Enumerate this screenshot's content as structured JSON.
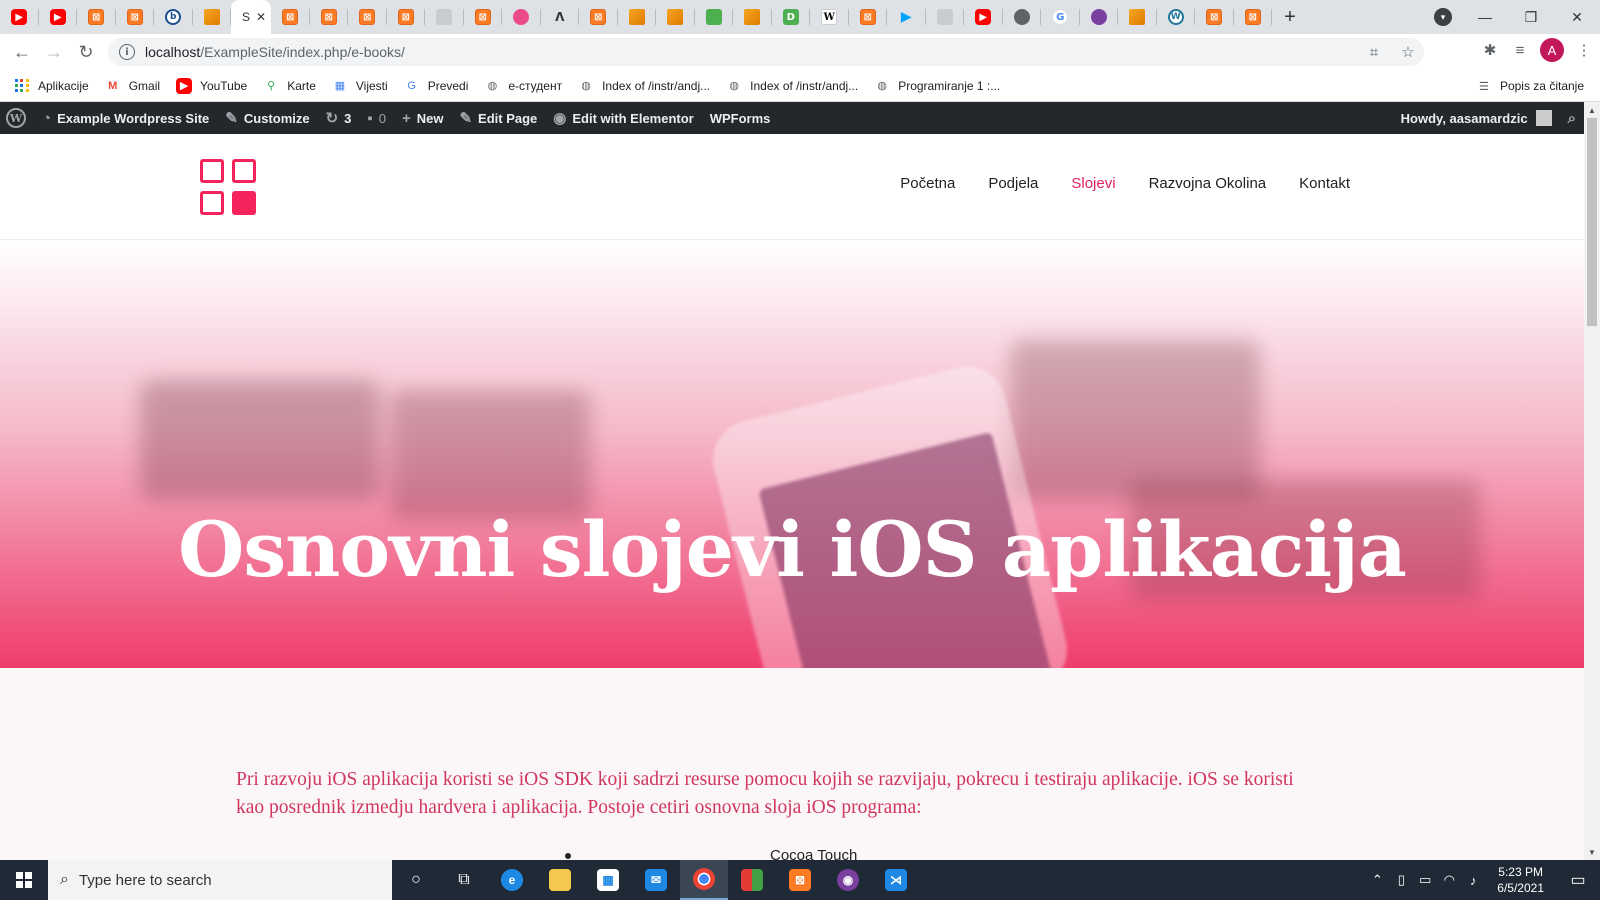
{
  "browser": {
    "tabs": [
      {
        "favicon": "youtube-icon"
      },
      {
        "favicon": "youtube-icon"
      },
      {
        "favicon": "xampp-icon"
      },
      {
        "favicon": "xampp-icon"
      },
      {
        "favicon": "b-icon"
      },
      {
        "favicon": "phpmyadmin-icon"
      },
      {
        "favicon": "page-icon",
        "title": "S",
        "active": true
      },
      {
        "favicon": "xampp-icon"
      },
      {
        "favicon": "xampp-icon"
      },
      {
        "favicon": "xampp-icon"
      },
      {
        "favicon": "xampp-icon"
      },
      {
        "favicon": "xampp-icon"
      },
      {
        "favicon": "xampp-icon"
      },
      {
        "favicon": "dribbble-icon"
      },
      {
        "favicon": "delta-icon"
      },
      {
        "favicon": "xampp-icon"
      },
      {
        "favicon": "phpmyadmin-icon"
      },
      {
        "favicon": "phpmyadmin-icon"
      },
      {
        "favicon": "green-icon"
      },
      {
        "favicon": "folder-icon"
      },
      {
        "favicon": "d-icon"
      },
      {
        "favicon": "wikipedia-icon"
      },
      {
        "favicon": "xampp-icon"
      },
      {
        "favicon": "play-icon"
      },
      {
        "favicon": "people-icon"
      },
      {
        "favicon": "youtube-icon"
      },
      {
        "favicon": "globe-icon"
      },
      {
        "favicon": "google-icon"
      },
      {
        "favicon": "purple-icon"
      },
      {
        "favicon": "yellow-icon"
      },
      {
        "favicon": "wordpress-icon"
      },
      {
        "favicon": "xampp-icon"
      },
      {
        "favicon": "xampp-icon"
      }
    ],
    "url_host": "localhost",
    "url_path": "/ExampleSite/index.php/e-books/",
    "profile_initial": "A",
    "bookmarks": [
      {
        "label": "Aplikacije",
        "icon": "apps-grid-icon"
      },
      {
        "label": "Gmail",
        "icon": "gmail-icon"
      },
      {
        "label": "YouTube",
        "icon": "youtube-icon"
      },
      {
        "label": "Karte",
        "icon": "maps-icon"
      },
      {
        "label": "Vijesti",
        "icon": "news-icon"
      },
      {
        "label": "Prevedi",
        "icon": "translate-icon"
      },
      {
        "label": "e-студент",
        "icon": "globe-icon"
      },
      {
        "label": "Index of /instr/andj...",
        "icon": "globe-icon"
      },
      {
        "label": "Index of /instr/andj...",
        "icon": "globe-icon"
      },
      {
        "label": "Programiranje 1 :...",
        "icon": "globe-icon"
      }
    ],
    "reading_list": "Popis za čitanje"
  },
  "adminbar": {
    "site_name": "Example Wordpress Site",
    "customize": "Customize",
    "updates_count": "3",
    "comments_count": "0",
    "new": "New",
    "edit_page": "Edit Page",
    "edit_elementor": "Edit with Elementor",
    "wpforms": "WPForms",
    "howdy": "Howdy, aasamardzic"
  },
  "site": {
    "nav": [
      "Početna",
      "Podjela",
      "Slojevi",
      "Razvojna Okolina",
      "Kontakt"
    ],
    "current_nav": "Slojevi",
    "accent_color": "#e0245e",
    "hero_title": "Osnovni slojevi iOS aplikacija",
    "intro": "Pri razvoju iOS aplikacija koristi se iOS SDK koji sadrzi resurse pomocu kojih se razvijaju, pokrecu i testiraju aplikacije. iOS se koristi kao posrednik izmedju hardvera i aplikacija. Postoje cetiri osnovna sloja iOS programa:",
    "list": [
      "Cocoa Touch"
    ]
  },
  "taskbar": {
    "search_placeholder": "Type here to search",
    "time": "5:23 PM",
    "date": "6/5/2021"
  }
}
